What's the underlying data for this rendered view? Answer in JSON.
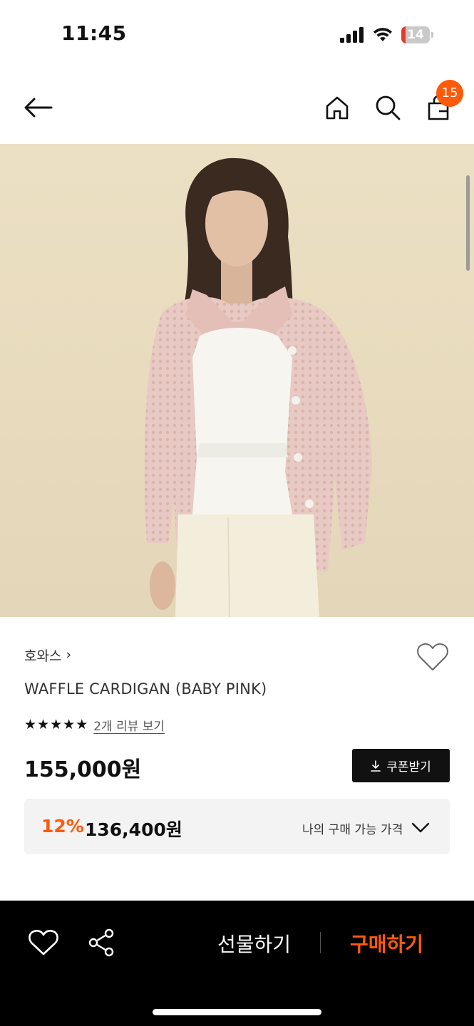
{
  "status_bar": {
    "time": "11:45",
    "battery_level": "14",
    "battery_fraction": 0.14,
    "icons": [
      "cellular-signal-icon",
      "wifi-icon",
      "battery-icon"
    ]
  },
  "nav": {
    "icons": [
      "back-arrow-icon",
      "home-icon",
      "search-icon",
      "shopping-bag-icon"
    ],
    "cart_count": "15"
  },
  "hero": {
    "icon": "product-photo",
    "colors": {
      "background": "#e8dcc0",
      "cardigan": "#e8c9c3",
      "blouse": "#f7f5f0",
      "pants": "#f3eedb"
    }
  },
  "product": {
    "brand": "호와스",
    "brand_chevron": "›",
    "title": "WAFFLE CARDIGAN (BABY PINK)",
    "rating_stars": 5,
    "review_link": "2개 리뷰 보기",
    "price": "155,000원",
    "coupon_button": "쿠폰받기",
    "discount_rate": "12%",
    "discount_price": "136,400원",
    "my_price_label": "나의 구매 가능 가격"
  },
  "bottom_bar": {
    "gift_label": "선물하기",
    "buy_label": "구매하기"
  },
  "colors": {
    "accent": "#ff5a0a",
    "dark": "#111111",
    "panel": "#f3f3f3"
  }
}
